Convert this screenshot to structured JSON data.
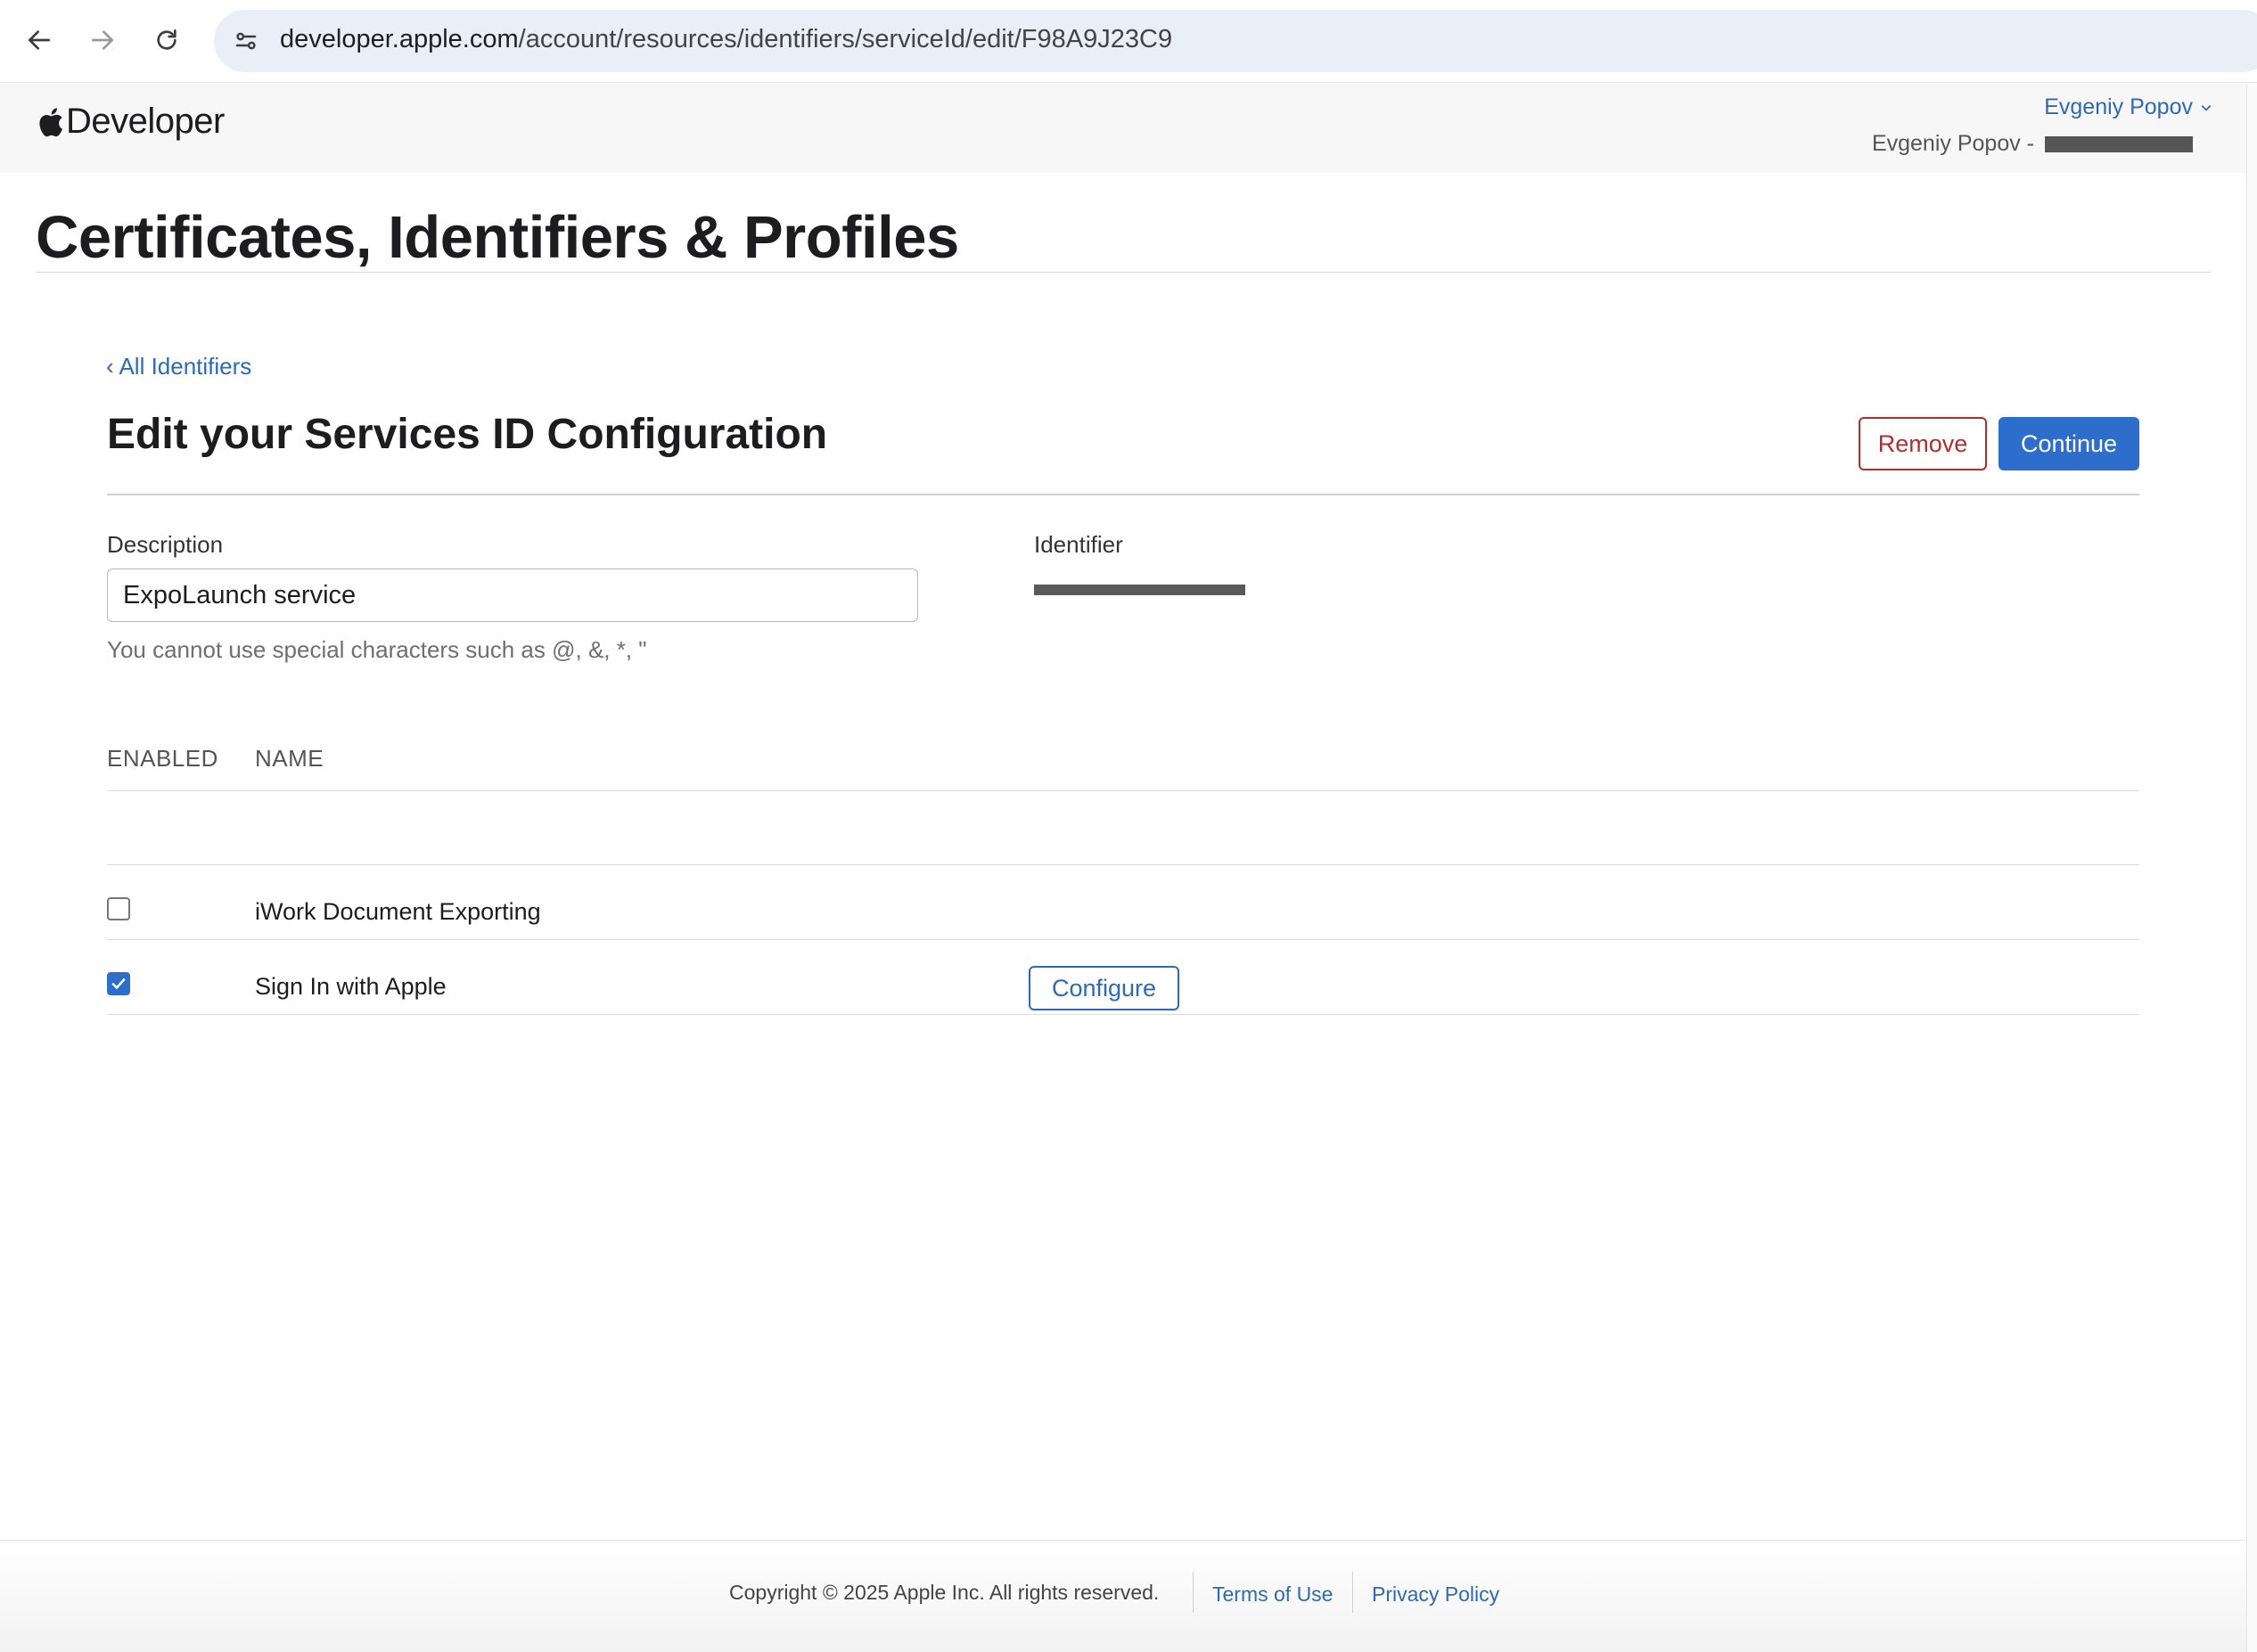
{
  "browser": {
    "url_host": "developer.apple.com",
    "url_path": "/account/resources/identifiers/serviceId/edit/F98A9J23C9"
  },
  "header": {
    "logo_text": "Developer",
    "account_name": "Evgeniy Popov",
    "team_prefix": "Evgeniy Popov -"
  },
  "page": {
    "title": "Certificates, Identifiers & Profiles",
    "back_link": "‹ All Identifiers",
    "section_title": "Edit your Services ID Configuration",
    "remove_label": "Remove",
    "continue_label": "Continue"
  },
  "form": {
    "description_label": "Description",
    "description_value": "ExpoLaunch service",
    "description_hint": "You cannot use special characters such as @, &, *, \"",
    "identifier_label": "Identifier"
  },
  "capabilities": {
    "col_enabled": "ENABLED",
    "col_name": "NAME",
    "rows": [
      {
        "name": "iWork Document Exporting",
        "enabled": false
      },
      {
        "name": "Sign In with Apple",
        "enabled": true,
        "action": "Configure"
      }
    ]
  },
  "footer": {
    "copyright": "Copyright © 2025 Apple Inc. All rights reserved.",
    "terms": "Terms of Use",
    "privacy": "Privacy Policy"
  },
  "colors": {
    "accent": "#2d6dcc",
    "link": "#2d6ab5",
    "danger": "#b32d2e"
  }
}
